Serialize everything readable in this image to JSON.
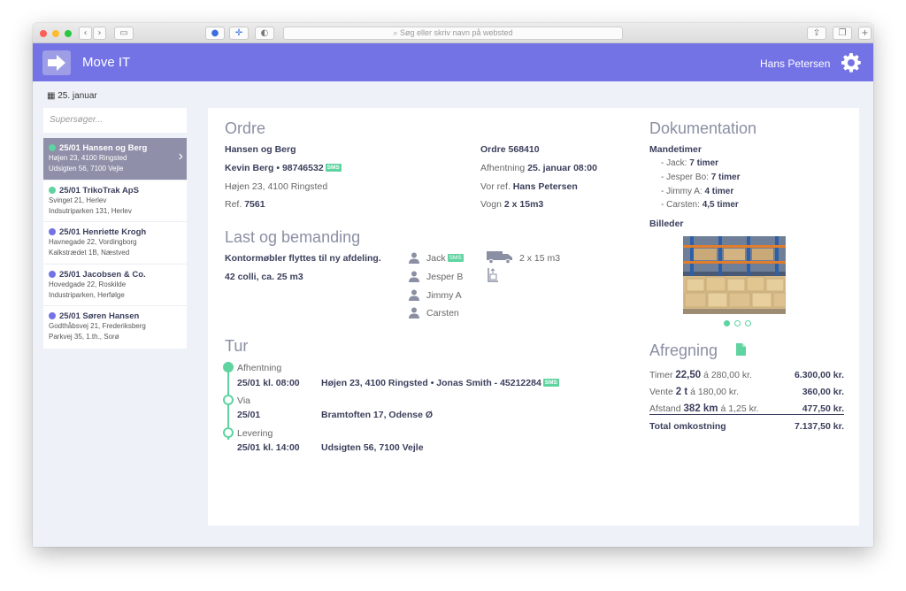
{
  "browser": {
    "url_placeholder": "Søg eller skriv navn på websted"
  },
  "app": {
    "title": "Move IT",
    "user": "Hans Petersen"
  },
  "sidebar": {
    "date": "25. januar",
    "search_placeholder": "Supersøger...",
    "items": [
      {
        "title": "25/01 Hansen og Berg",
        "line1": "Højen 23, 4100 Ringsted",
        "line2": "Udsigten 56, 7100 Vejle",
        "color": "#5fd3a0"
      },
      {
        "title": "25/01 TrikoTrak ApS",
        "line1": "Svinget 21, Herlev",
        "line2": "Indsutriparken 131, Herlev",
        "color": "#5fd3a0"
      },
      {
        "title": "25/01 Henriette Krogh",
        "line1": "Havnegade 22, Vordingborg",
        "line2": "Kalkstrædet 1B, Næstved",
        "color": "#7473e6"
      },
      {
        "title": "25/01 Jacobsen & Co.",
        "line1": "Hovedgade 22, Roskilde",
        "line2": "Industriparken, Herfølge",
        "color": "#7473e6"
      },
      {
        "title": "25/01 Søren Hansen",
        "line1": "Godthåbsvej 21, Frederiksberg",
        "line2": "Parkvej 35, 1.th., Sorø",
        "color": "#7473e6"
      }
    ]
  },
  "ordre": {
    "heading": "Ordre",
    "customer": "Hansen og Berg",
    "contact": "Kevin Berg • 98746532",
    "sms": "SMS",
    "address": "Højen 23, 4100 Ringsted",
    "ref_label": "Ref.",
    "ref": "7561",
    "order": "Ordre 568410",
    "pickup_label": "Afhentning",
    "pickup": "25. januar 08:00",
    "ourref_label": "Vor ref.",
    "ourref": "Hans Petersen",
    "vehicle_label": "Vogn",
    "vehicle": "2 x 15m3"
  },
  "last": {
    "heading": "Last og bemanding",
    "desc": "Kontormøbler flyttes til ny afdeling.",
    "volume": "42 colli, ca. 25 m3",
    "crew": [
      "Jack",
      "Jesper B",
      "Jimmy A",
      "Carsten"
    ],
    "truck": "2 x 15 m3"
  },
  "tur": {
    "heading": "Tur",
    "stops": [
      {
        "label": "Afhentning",
        "time": "25/01 kl. 08:00",
        "addr": "Højen 23, 4100 Ringsted • Jonas Smith - 45212284",
        "sms": "SMS"
      },
      {
        "label": "Via",
        "time": "25/01",
        "addr": "Bramtoften 17, Odense Ø"
      },
      {
        "label": "Levering",
        "time": "25/01 kl. 14:00",
        "addr": "Udsigten 56, 7100 Vejle"
      }
    ]
  },
  "dok": {
    "heading": "Dokumentation",
    "hours_title": "Mandetimer",
    "hours": [
      {
        "name": "- Jack:",
        "val": "7 timer"
      },
      {
        "name": "- Jesper Bo:",
        "val": "7 timer"
      },
      {
        "name": "- Jimmy A:",
        "val": "4 timer"
      },
      {
        "name": "- Carsten:",
        "val": "4,5 timer"
      }
    ],
    "images_title": "Billeder"
  },
  "afr": {
    "heading": "Afregning",
    "rows": [
      {
        "pre": "Timer",
        "bold": "22,50",
        "post": "á 280,00 kr.",
        "amount": "6.300,00 kr."
      },
      {
        "pre": "Vente",
        "bold": "2 t",
        "post": "á 180,00 kr.",
        "amount": "360,00 kr."
      },
      {
        "pre": "Afstand",
        "bold": "382 km",
        "post": "á 1,25 kr.",
        "amount": "477,50 kr."
      }
    ],
    "total_label": "Total omkostning",
    "total": "7.137,50 kr."
  }
}
